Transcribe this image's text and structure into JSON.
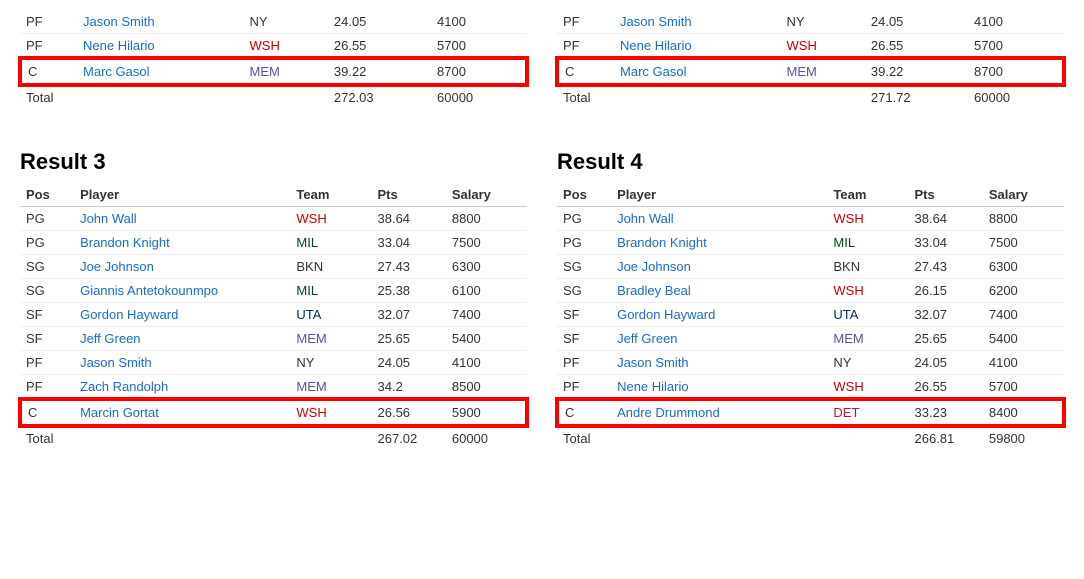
{
  "results": [
    {
      "id": "result3",
      "title": "Result 3",
      "columns": [
        "Pos",
        "Player",
        "Team",
        "Pts",
        "Salary"
      ],
      "rows": [
        {
          "pos": "PG",
          "player": "John Wall",
          "team": "WSH",
          "teamClass": "team-wsh",
          "pts": "38.64",
          "salary": "8800",
          "highlight": false
        },
        {
          "pos": "PG",
          "player": "Brandon Knight",
          "team": "MIL",
          "teamClass": "team-mil",
          "pts": "33.04",
          "salary": "7500",
          "highlight": false
        },
        {
          "pos": "SG",
          "player": "Joe Johnson",
          "team": "BKN",
          "teamClass": "team-bkn",
          "pts": "27.43",
          "salary": "6300",
          "highlight": false
        },
        {
          "pos": "SG",
          "player": "Giannis Antetokounmpo",
          "team": "MIL",
          "teamClass": "team-mil",
          "pts": "25.38",
          "salary": "6100",
          "highlight": false
        },
        {
          "pos": "SF",
          "player": "Gordon Hayward",
          "team": "UTA",
          "teamClass": "team-uta",
          "pts": "32.07",
          "salary": "7400",
          "highlight": false
        },
        {
          "pos": "SF",
          "player": "Jeff Green",
          "team": "MEM",
          "teamClass": "team-mem",
          "pts": "25.65",
          "salary": "5400",
          "highlight": false
        },
        {
          "pos": "PF",
          "player": "Jason Smith",
          "team": "NY",
          "teamClass": "team-ny",
          "pts": "24.05",
          "salary": "4100",
          "highlight": false
        },
        {
          "pos": "PF",
          "player": "Zach Randolph",
          "team": "MEM",
          "teamClass": "team-mem",
          "pts": "34.2",
          "salary": "8500",
          "highlight": false
        },
        {
          "pos": "C",
          "player": "Marcin Gortat",
          "team": "WSH",
          "teamClass": "team-wsh",
          "pts": "26.56",
          "salary": "5900",
          "highlight": true
        }
      ],
      "total": {
        "label": "Total",
        "pts": "267.02",
        "salary": "60000"
      }
    },
    {
      "id": "result4",
      "title": "Result 4",
      "columns": [
        "Pos",
        "Player",
        "Team",
        "Pts",
        "Salary"
      ],
      "rows": [
        {
          "pos": "PG",
          "player": "John Wall",
          "team": "WSH",
          "teamClass": "team-wsh",
          "pts": "38.64",
          "salary": "8800",
          "highlight": false
        },
        {
          "pos": "PG",
          "player": "Brandon Knight",
          "team": "MIL",
          "teamClass": "team-mil",
          "pts": "33.04",
          "salary": "7500",
          "highlight": false
        },
        {
          "pos": "SG",
          "player": "Joe Johnson",
          "team": "BKN",
          "teamClass": "team-bkn",
          "pts": "27.43",
          "salary": "6300",
          "highlight": false
        },
        {
          "pos": "SG",
          "player": "Bradley Beal",
          "team": "WSH",
          "teamClass": "team-wsh",
          "pts": "26.15",
          "salary": "6200",
          "highlight": false
        },
        {
          "pos": "SF",
          "player": "Gordon Hayward",
          "team": "UTA",
          "teamClass": "team-uta",
          "pts": "32.07",
          "salary": "7400",
          "highlight": false
        },
        {
          "pos": "SF",
          "player": "Jeff Green",
          "team": "MEM",
          "teamClass": "team-mem",
          "pts": "25.65",
          "salary": "5400",
          "highlight": false
        },
        {
          "pos": "PF",
          "player": "Jason Smith",
          "team": "NY",
          "teamClass": "team-ny",
          "pts": "24.05",
          "salary": "4100",
          "highlight": false
        },
        {
          "pos": "PF",
          "player": "Nene Hilario",
          "team": "WSH",
          "teamClass": "team-wsh",
          "pts": "26.55",
          "salary": "5700",
          "highlight": false
        },
        {
          "pos": "C",
          "player": "Andre Drummond",
          "team": "DET",
          "teamClass": "team-det",
          "pts": "33.23",
          "salary": "8400",
          "highlight": true
        }
      ],
      "total": {
        "label": "Total",
        "pts": "266.81",
        "salary": "59800"
      }
    }
  ],
  "top_results": [
    {
      "id": "result1",
      "rows": [
        {
          "pos": "PF",
          "player": "Jason Smith",
          "team": "NY",
          "teamClass": "team-ny",
          "pts": "24.05",
          "salary": "4100",
          "highlight": false
        },
        {
          "pos": "PF",
          "player": "Nene Hilario",
          "team": "WSH",
          "teamClass": "team-wsh",
          "pts": "26.55",
          "salary": "5700",
          "highlight": false
        },
        {
          "pos": "C",
          "player": "Marc Gasol",
          "team": "MEM",
          "teamClass": "team-mem",
          "pts": "39.22",
          "salary": "8700",
          "highlight": true
        }
      ],
      "total": {
        "label": "Total",
        "pts": "272.03",
        "salary": "60000"
      }
    },
    {
      "id": "result2",
      "rows": [
        {
          "pos": "PF",
          "player": "Jason Smith",
          "team": "NY",
          "teamClass": "team-ny",
          "pts": "24.05",
          "salary": "4100",
          "highlight": false
        },
        {
          "pos": "PF",
          "player": "Nene Hilario",
          "team": "WSH",
          "teamClass": "team-wsh",
          "pts": "26.55",
          "salary": "5700",
          "highlight": false
        },
        {
          "pos": "C",
          "player": "Marc Gasol",
          "team": "MEM",
          "teamClass": "team-mem",
          "pts": "39.22",
          "salary": "8700",
          "highlight": true
        }
      ],
      "total": {
        "label": "Total",
        "pts": "271.72",
        "salary": "60000"
      }
    }
  ]
}
